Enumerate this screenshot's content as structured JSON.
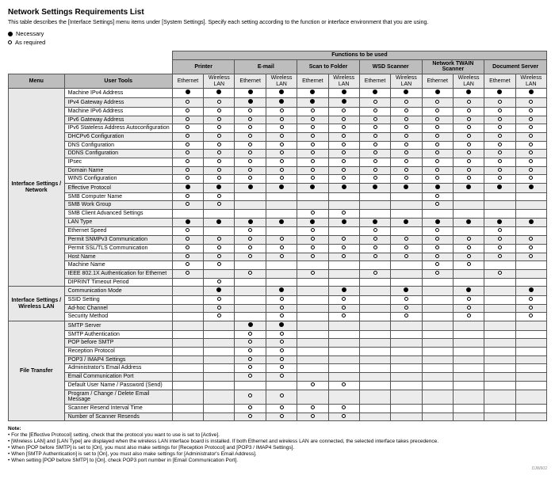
{
  "title": "Network Settings Requirements List",
  "intro": "This table describes the [Interface Settings] menu items under [System Settings]. Specify each setting according to the function or interface environment that you are using.",
  "legend": {
    "necessary": "Necessary",
    "as_required": "As required"
  },
  "headers": {
    "functions": "Functions to be used",
    "menu": "Menu",
    "user_tools": "User Tools",
    "groups": [
      "Printer",
      "E-mail",
      "Scan to Folder",
      "WSD Scanner",
      "Network TWAIN Scanner",
      "Document Server"
    ],
    "sub": {
      "eth": "Ethernet",
      "wlan": "Wireless LAN"
    }
  },
  "sections": [
    {
      "menu": "Interface Settings / Network",
      "rows": [
        {
          "label": "Machine IPv4 Address",
          "marks": [
            "f",
            "f",
            "f",
            "f",
            "f",
            "f",
            "f",
            "f",
            "f",
            "f",
            "f",
            "f"
          ]
        },
        {
          "label": "IPv4 Gateway Address",
          "marks": [
            "o",
            "o",
            "f",
            "f",
            "f",
            "f",
            "o",
            "o",
            "o",
            "o",
            "o",
            "o"
          ]
        },
        {
          "label": "Machine IPv6 Address",
          "marks": [
            "o",
            "o",
            "o",
            "o",
            "o",
            "o",
            "o",
            "o",
            "o",
            "o",
            "o",
            "o"
          ]
        },
        {
          "label": "IPv6 Gateway Address",
          "marks": [
            "o",
            "o",
            "o",
            "o",
            "o",
            "o",
            "o",
            "o",
            "o",
            "o",
            "o",
            "o"
          ]
        },
        {
          "label": "IPv6 Stateless Address Autoconfiguration",
          "marks": [
            "o",
            "o",
            "o",
            "o",
            "o",
            "o",
            "o",
            "o",
            "o",
            "o",
            "o",
            "o"
          ]
        },
        {
          "label": "DHCPv6 Configuration",
          "marks": [
            "o",
            "o",
            "o",
            "o",
            "o",
            "o",
            "o",
            "o",
            "o",
            "o",
            "o",
            "o"
          ]
        },
        {
          "label": "DNS Configuration",
          "marks": [
            "o",
            "o",
            "o",
            "o",
            "o",
            "o",
            "o",
            "o",
            "o",
            "o",
            "o",
            "o"
          ]
        },
        {
          "label": "DDNS Configuration",
          "marks": [
            "o",
            "o",
            "o",
            "o",
            "o",
            "o",
            "o",
            "o",
            "o",
            "o",
            "o",
            "o"
          ]
        },
        {
          "label": "IPsec",
          "marks": [
            "o",
            "o",
            "o",
            "o",
            "o",
            "o",
            "o",
            "o",
            "o",
            "o",
            "o",
            "o"
          ]
        },
        {
          "label": "Domain Name",
          "marks": [
            "o",
            "o",
            "o",
            "o",
            "o",
            "o",
            "o",
            "o",
            "o",
            "o",
            "o",
            "o"
          ]
        },
        {
          "label": "WINS Configuration",
          "marks": [
            "o",
            "o",
            "o",
            "o",
            "o",
            "o",
            "o",
            "o",
            "o",
            "o",
            "o",
            "o"
          ]
        },
        {
          "label": "Effective Protocol",
          "marks": [
            "f",
            "f",
            "f",
            "f",
            "f",
            "f",
            "f",
            "f",
            "f",
            "f",
            "f",
            "f"
          ]
        },
        {
          "label": "SMB Computer Name",
          "marks": [
            "o",
            "o",
            "",
            "",
            "",
            "",
            "",
            "",
            "o",
            "",
            "",
            ""
          ]
        },
        {
          "label": "SMB Work Group",
          "marks": [
            "o",
            "o",
            "",
            "",
            "",
            "",
            "",
            "",
            "o",
            "",
            "",
            ""
          ]
        },
        {
          "label": "SMB Client Advanced Settings",
          "marks": [
            "",
            "",
            "",
            "",
            "o",
            "o",
            "",
            "",
            "",
            "",
            "",
            ""
          ]
        },
        {
          "label": "LAN Type",
          "marks": [
            "f",
            "f",
            "f",
            "f",
            "f",
            "f",
            "f",
            "f",
            "f",
            "f",
            "f",
            "f"
          ]
        },
        {
          "label": "Ethernet Speed",
          "marks": [
            "o",
            "",
            "o",
            "",
            "o",
            "",
            "o",
            "",
            "o",
            "",
            "o",
            ""
          ]
        },
        {
          "label": "Permit SNMPv3 Communication",
          "marks": [
            "o",
            "o",
            "o",
            "o",
            "o",
            "o",
            "o",
            "o",
            "o",
            "o",
            "o",
            "o"
          ]
        },
        {
          "label": "Permit SSL/TLS Communication",
          "marks": [
            "o",
            "o",
            "o",
            "o",
            "o",
            "o",
            "o",
            "o",
            "o",
            "o",
            "o",
            "o"
          ]
        },
        {
          "label": "Host Name",
          "marks": [
            "o",
            "o",
            "o",
            "o",
            "o",
            "o",
            "o",
            "o",
            "o",
            "o",
            "o",
            "o"
          ]
        },
        {
          "label": "Machine Name",
          "marks": [
            "o",
            "o",
            "",
            "",
            "",
            "",
            "",
            "",
            "o",
            "o",
            "",
            ""
          ]
        },
        {
          "label": "IEEE 802.1X Authentication for Ethernet",
          "marks": [
            "o",
            "",
            "o",
            "",
            "o",
            "",
            "o",
            "",
            "o",
            "",
            "o",
            ""
          ]
        },
        {
          "label": "DIPRINT Timeout Period",
          "marks": [
            "",
            "o",
            "",
            "",
            "",
            "",
            "",
            "",
            "",
            "",
            "",
            ""
          ]
        }
      ]
    },
    {
      "menu": "Interface Settings / Wireless LAN",
      "rows": [
        {
          "label": "Communication Mode",
          "marks": [
            "",
            "f",
            "",
            "f",
            "",
            "f",
            "",
            "f",
            "",
            "f",
            "",
            "f"
          ]
        },
        {
          "label": "SSID Setting",
          "marks": [
            "",
            "o",
            "",
            "o",
            "",
            "o",
            "",
            "o",
            "",
            "o",
            "",
            "o"
          ]
        },
        {
          "label": "Ad-hoc Channel",
          "marks": [
            "",
            "o",
            "",
            "o",
            "",
            "o",
            "",
            "o",
            "",
            "o",
            "",
            "o"
          ]
        },
        {
          "label": "Security Method",
          "marks": [
            "",
            "o",
            "",
            "o",
            "",
            "o",
            "",
            "o",
            "",
            "o",
            "",
            "o"
          ]
        }
      ]
    },
    {
      "menu": "File Transfer",
      "rows": [
        {
          "label": "SMTP Server",
          "marks": [
            "",
            "",
            "f",
            "f",
            "",
            "",
            "",
            "",
            "",
            "",
            "",
            ""
          ]
        },
        {
          "label": "SMTP Authentication",
          "marks": [
            "",
            "",
            "o",
            "o",
            "",
            "",
            "",
            "",
            "",
            "",
            "",
            ""
          ]
        },
        {
          "label": "POP before SMTP",
          "marks": [
            "",
            "",
            "o",
            "o",
            "",
            "",
            "",
            "",
            "",
            "",
            "",
            ""
          ]
        },
        {
          "label": "Reception Protocol",
          "marks": [
            "",
            "",
            "o",
            "o",
            "",
            "",
            "",
            "",
            "",
            "",
            "",
            ""
          ]
        },
        {
          "label": "POP3 / IMAP4 Settings",
          "marks": [
            "",
            "",
            "o",
            "o",
            "",
            "",
            "",
            "",
            "",
            "",
            "",
            ""
          ]
        },
        {
          "label": "Administrator's Email Address",
          "marks": [
            "",
            "",
            "o",
            "o",
            "",
            "",
            "",
            "",
            "",
            "",
            "",
            ""
          ]
        },
        {
          "label": "Email Communication Port",
          "marks": [
            "",
            "",
            "o",
            "o",
            "",
            "",
            "",
            "",
            "",
            "",
            "",
            ""
          ]
        },
        {
          "label": "Default User Name / Password (Send)",
          "marks": [
            "",
            "",
            "",
            "",
            "o",
            "o",
            "",
            "",
            "",
            "",
            "",
            ""
          ]
        },
        {
          "label": "Program / Change / Delete Email Message",
          "marks": [
            "",
            "",
            "o",
            "o",
            "",
            "",
            "",
            "",
            "",
            "",
            "",
            ""
          ]
        },
        {
          "label": "Scanner Resend Interval Time",
          "marks": [
            "",
            "",
            "o",
            "o",
            "o",
            "o",
            "",
            "",
            "",
            "",
            "",
            ""
          ]
        },
        {
          "label": "Number of Scanner Resends",
          "marks": [
            "",
            "",
            "o",
            "o",
            "o",
            "o",
            "",
            "",
            "",
            "",
            "",
            ""
          ]
        }
      ]
    }
  ],
  "notes": {
    "title": "Note:",
    "items": [
      "For the [Effective Protocol] setting, check that the protocol you want to use is set to [Active].",
      "[Wireless LAN] and [LAN Type] are displayed when the wireless LAN interface board is installed. If both Ethernet and wireless LAN are connected, the selected interface takes precedence.",
      "When [POP before SMTP] is set to [On], you must also make settings for [Reception Protocol] and [POP3 / IMAP4 Settings].",
      "When [SMTP Authentication] is set to [On], you must also make settings for [Administrator's Email Address].",
      "When setting [POP before SMTP] to [On], check POP3 port number in [Email Communication Port]."
    ]
  },
  "page_id": "DJW602"
}
